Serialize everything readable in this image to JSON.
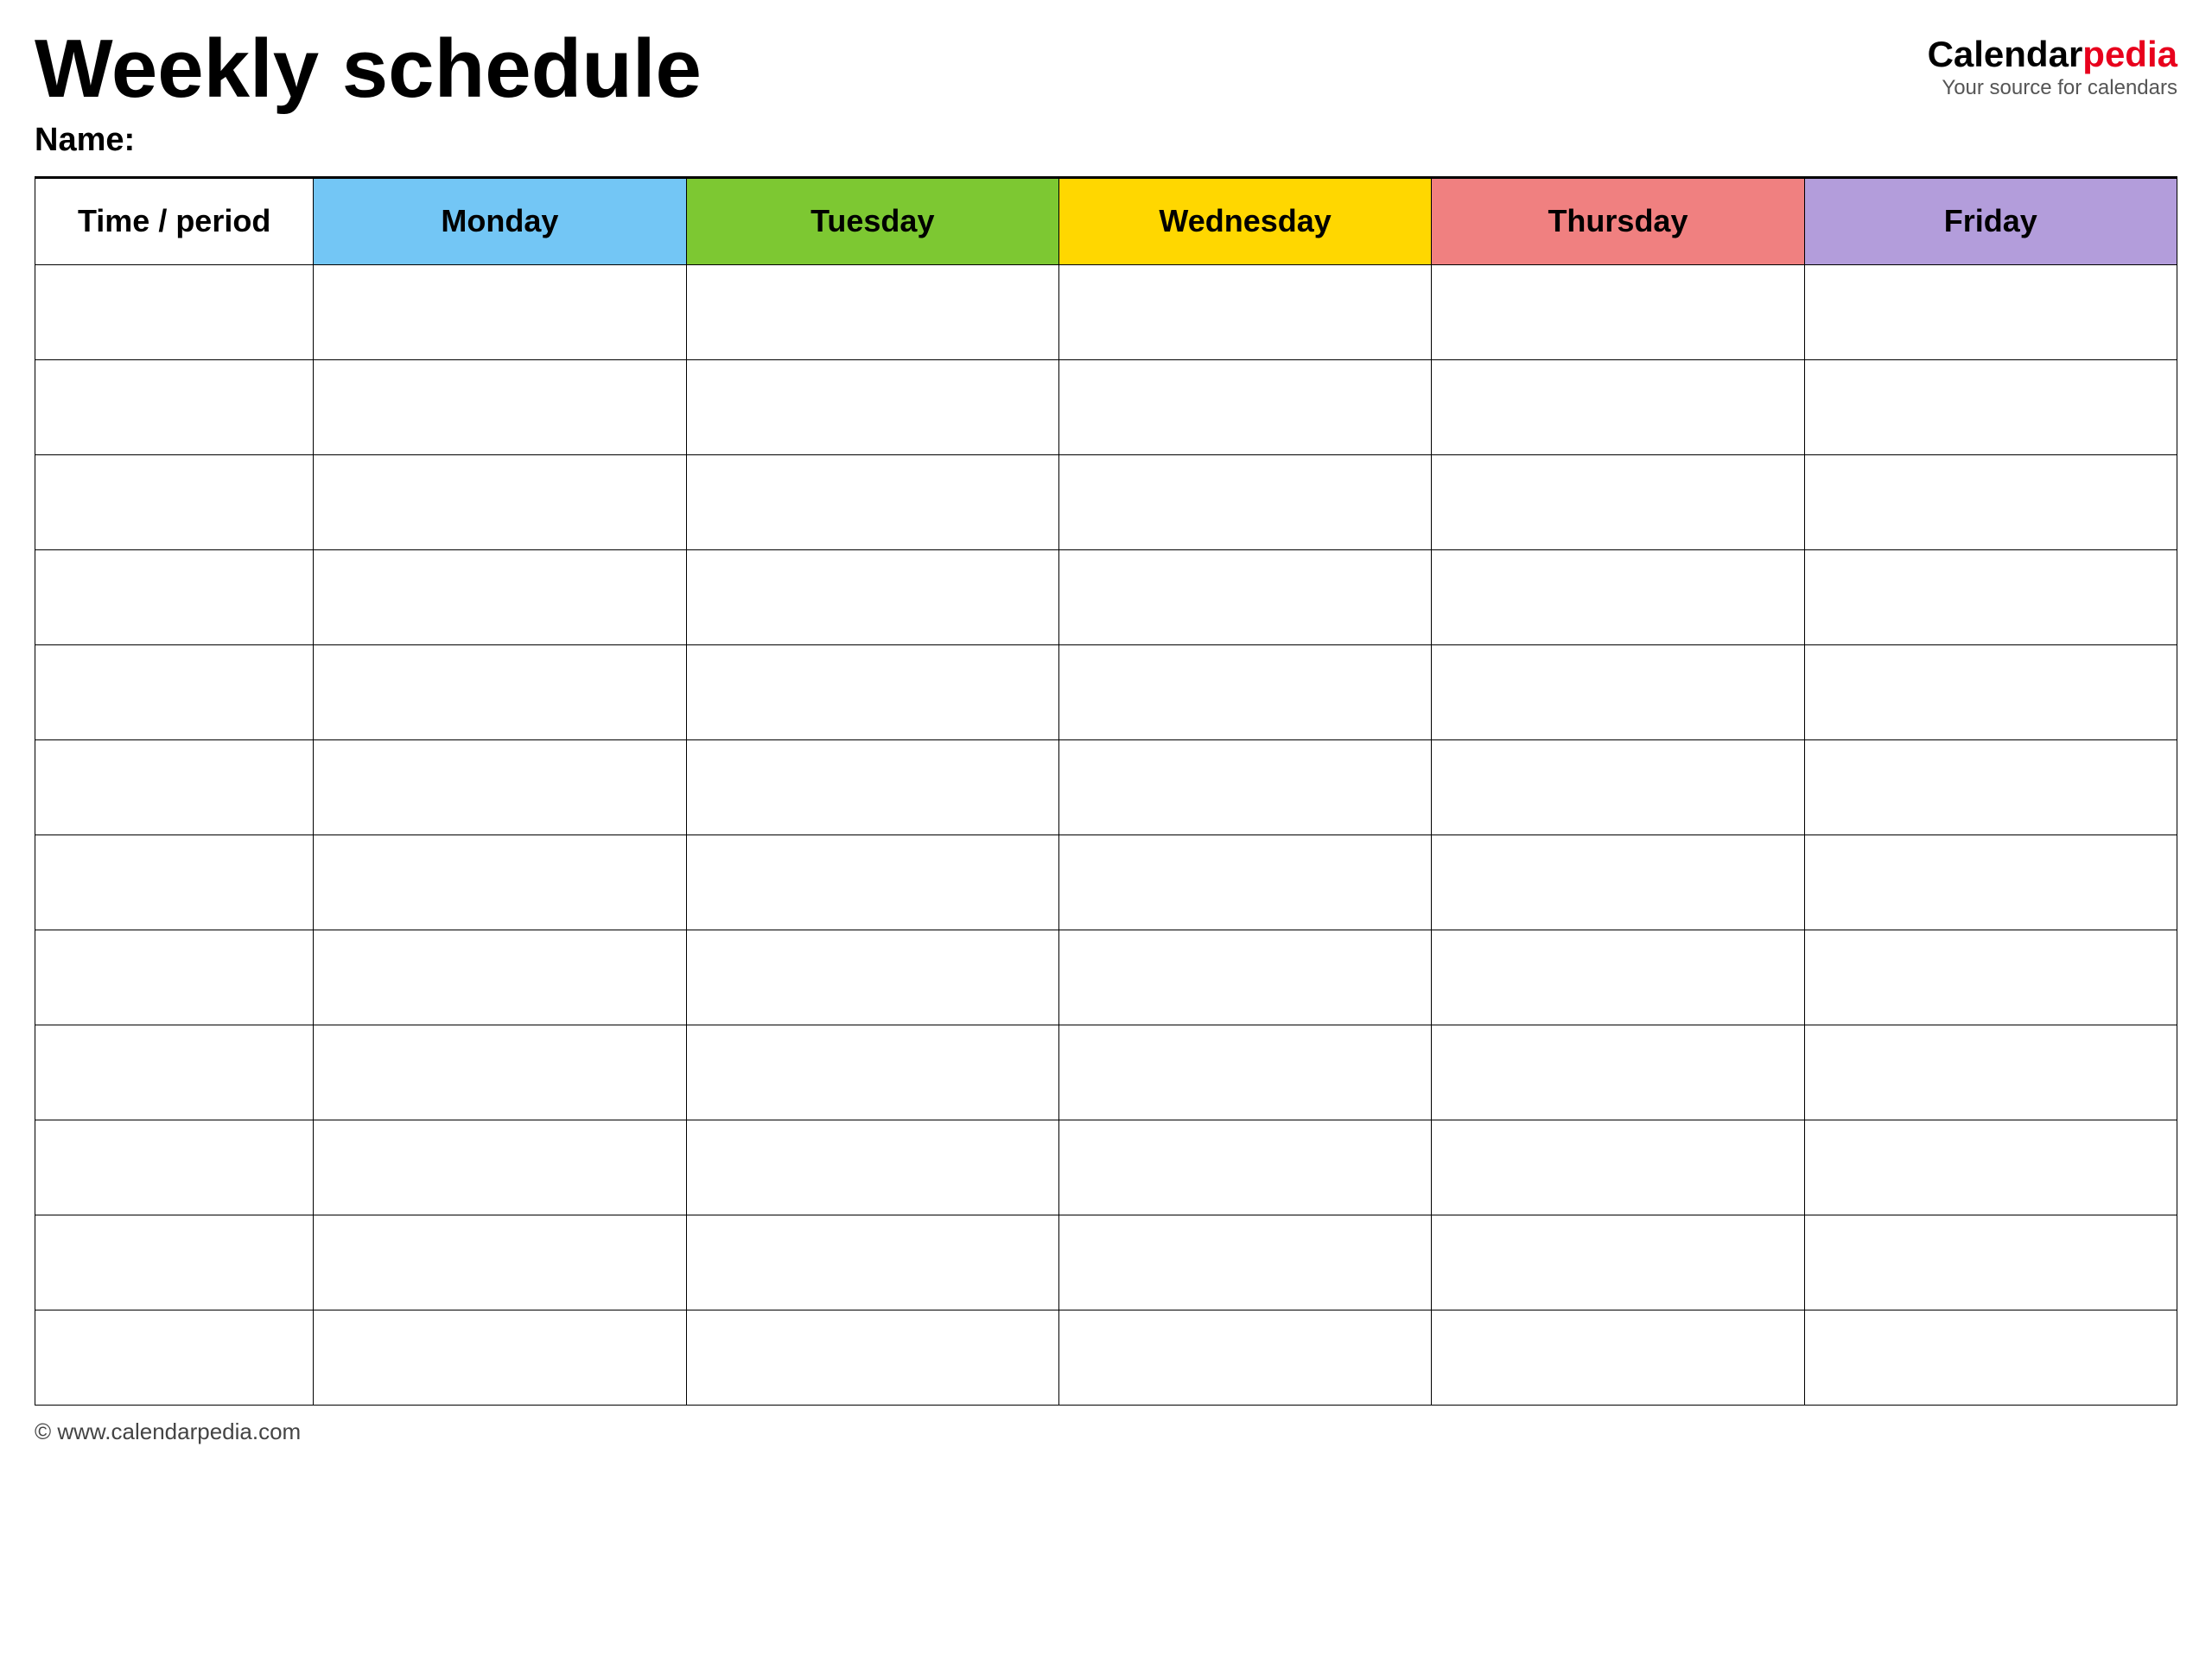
{
  "header": {
    "title": "Weekly schedule",
    "name_label": "Name:",
    "logo_calendar": "Calendar",
    "logo_pedia": "pedia",
    "logo_tagline": "Your source for calendars"
  },
  "table": {
    "columns": [
      {
        "label": "Time / period",
        "class": "col-time"
      },
      {
        "label": "Monday",
        "class": "col-monday"
      },
      {
        "label": "Tuesday",
        "class": "col-tuesday"
      },
      {
        "label": "Wednesday",
        "class": "col-wednesday"
      },
      {
        "label": "Thursday",
        "class": "col-thursday"
      },
      {
        "label": "Friday",
        "class": "col-friday"
      }
    ],
    "row_count": 12
  },
  "footer": {
    "url": "© www.calendarpedia.com"
  }
}
